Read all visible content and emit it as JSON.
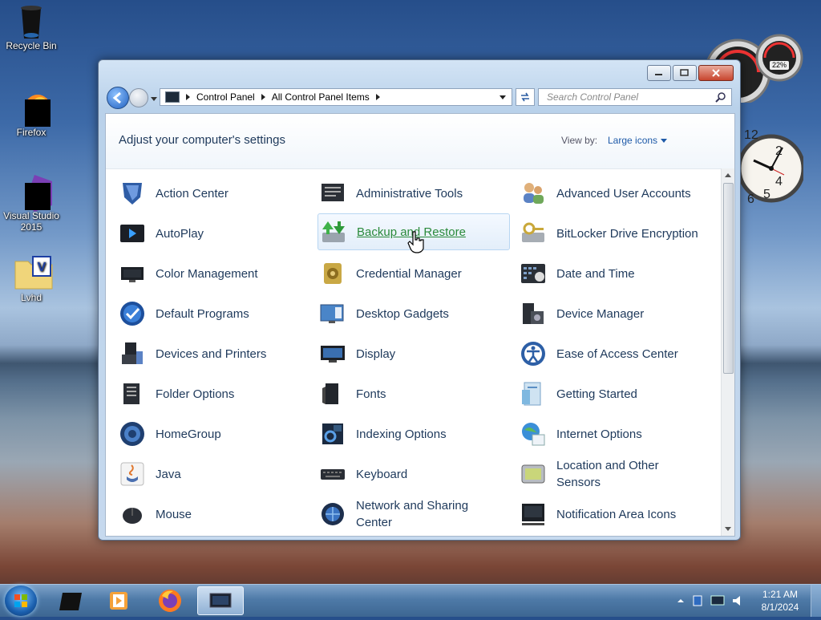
{
  "desktop": {
    "icons": [
      {
        "label": "Recycle Bin"
      },
      {
        "label": "Firefox"
      },
      {
        "label": "Visual Studio 2015"
      },
      {
        "label": "Lvhd"
      }
    ]
  },
  "gadgets": {
    "meter_label": "22%",
    "clock_numbers": [
      "12",
      "2",
      "4",
      "5",
      "6"
    ]
  },
  "window": {
    "breadcrumb": [
      "Control Panel",
      "All Control Panel Items"
    ],
    "search_placeholder": "Search Control Panel",
    "header_title": "Adjust your computer's settings",
    "view_by_label": "View by:",
    "view_by_value": "Large icons",
    "items": [
      {
        "label": "Action Center",
        "icon": "shield-flag-icon"
      },
      {
        "label": "Administrative Tools",
        "icon": "admin-tools-icon"
      },
      {
        "label": "Advanced User Accounts",
        "icon": "users-icon"
      },
      {
        "label": "AutoPlay",
        "icon": "autoplay-icon"
      },
      {
        "label": "Backup and Restore",
        "icon": "backup-icon"
      },
      {
        "label": "BitLocker Drive Encryption",
        "icon": "bitlocker-key-icon"
      },
      {
        "label": "Color Management",
        "icon": "color-monitor-icon"
      },
      {
        "label": "Credential Manager",
        "icon": "credential-vault-icon"
      },
      {
        "label": "Date and Time",
        "icon": "calendar-clock-icon"
      },
      {
        "label": "Default Programs",
        "icon": "default-programs-icon"
      },
      {
        "label": "Desktop Gadgets",
        "icon": "gadgets-icon"
      },
      {
        "label": "Device Manager",
        "icon": "device-manager-icon"
      },
      {
        "label": "Devices and Printers",
        "icon": "printer-icon"
      },
      {
        "label": "Display",
        "icon": "display-icon"
      },
      {
        "label": "Ease of Access Center",
        "icon": "ease-of-access-icon"
      },
      {
        "label": "Folder Options",
        "icon": "folder-options-icon"
      },
      {
        "label": "Fonts",
        "icon": "fonts-icon"
      },
      {
        "label": "Getting Started",
        "icon": "getting-started-icon"
      },
      {
        "label": "HomeGroup",
        "icon": "homegroup-icon"
      },
      {
        "label": "Indexing Options",
        "icon": "indexing-icon"
      },
      {
        "label": "Internet Options",
        "icon": "globe-icon"
      },
      {
        "label": "Java",
        "icon": "java-icon"
      },
      {
        "label": "Keyboard",
        "icon": "keyboard-icon"
      },
      {
        "label": "Location and Other Sensors",
        "icon": "sensor-icon"
      },
      {
        "label": "Mouse",
        "icon": "mouse-icon"
      },
      {
        "label": "Network and Sharing Center",
        "icon": "network-icon"
      },
      {
        "label": "Notification Area Icons",
        "icon": "notification-icon"
      }
    ]
  },
  "taskbar": {
    "time": "1:21 AM",
    "date": "8/1/2024"
  },
  "colors": {
    "link_hover": "#2a8a3a",
    "title_text": "#1e395b",
    "accent": "#1e5aa8"
  }
}
